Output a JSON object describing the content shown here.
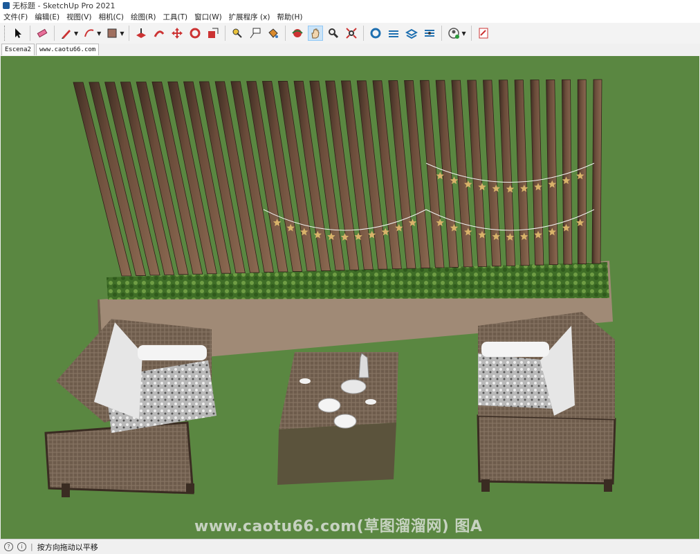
{
  "window": {
    "title": "无标题 - SketchUp Pro 2021"
  },
  "menu": [
    "文件(F)",
    "编辑(E)",
    "视图(V)",
    "相机(C)",
    "绘图(R)",
    "工具(T)",
    "窗口(W)",
    "扩展程序 (x)",
    "帮助(H)"
  ],
  "tabs": [
    {
      "label": "Escena2"
    },
    {
      "label": "www.caotu66.com"
    }
  ],
  "status": {
    "text": "按方向拖动以平移"
  },
  "watermark": "www.caotu66.com(草图溜溜网) 图A",
  "colors": {
    "ground": "#5a8741",
    "slat": "#7a5a44",
    "slat_dark": "#3e2c22",
    "planter": "#8c7562",
    "hedge": "#4a7a2e",
    "wicker": "#6b5a4a",
    "star": "#d9b36a"
  }
}
